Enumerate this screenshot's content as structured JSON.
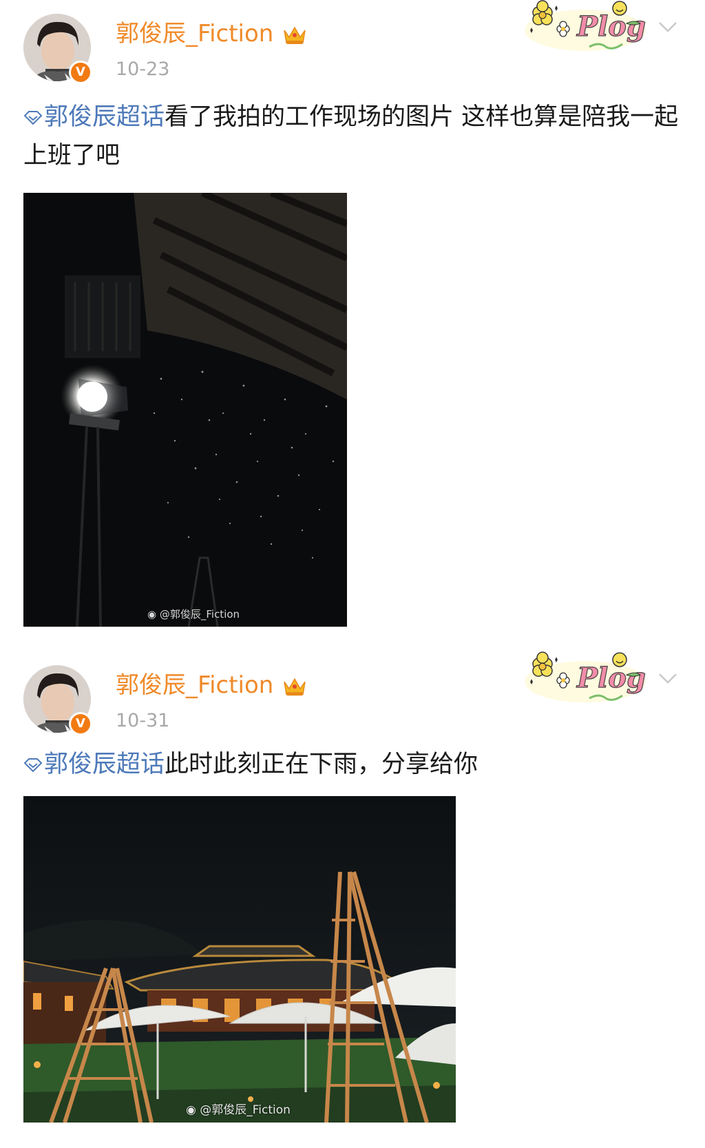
{
  "posts": [
    {
      "username": "郭俊辰_Fiction",
      "date": "10-23",
      "verified_mark": "V",
      "sticker_text": "Plog",
      "topic": "郭俊辰超话",
      "text": "看了我拍的工作现场的图片 这样也算是陪我一起上班了吧",
      "watermark": "@郭俊辰_Fiction"
    },
    {
      "username": "郭俊辰_Fiction",
      "date": "10-31",
      "verified_mark": "V",
      "sticker_text": "Plog",
      "topic": "郭俊辰超话",
      "text": "此时此刻正在下雨，分享给你",
      "watermark": "@郭俊辰_Fiction"
    }
  ],
  "colors": {
    "username": "#f08a2a",
    "topic_link": "#4d79b9",
    "date": "#a8a8a8",
    "verified_badge": "#f27a12"
  },
  "icons": {
    "badge": "crown-icon",
    "topic": "diamond-topic-icon",
    "menu": "chevron-down-icon",
    "verified": "verified-v-icon",
    "watermark_logo": "weibo-logo-icon"
  }
}
